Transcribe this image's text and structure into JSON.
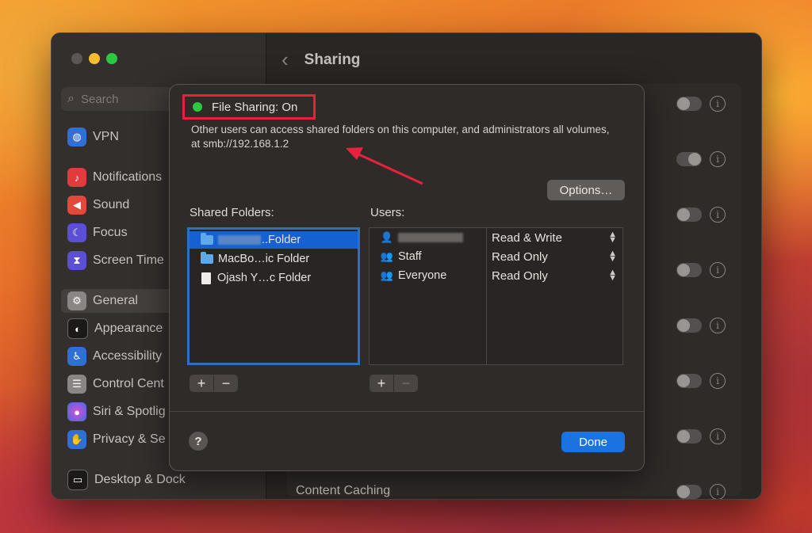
{
  "sidebar": {
    "search_placeholder": "Search",
    "items": [
      {
        "label": "VPN",
        "icon": "globe-icon",
        "color": "#2f6fd6"
      },
      {
        "label": "Notifications",
        "icon": "bell-icon",
        "color": "#e23b3b"
      },
      {
        "label": "Sound",
        "icon": "speaker-icon",
        "color": "#e2493b"
      },
      {
        "label": "Focus",
        "icon": "moon-icon",
        "color": "#5b4fd6"
      },
      {
        "label": "Screen Time",
        "icon": "hourglass-icon",
        "color": "#5b4fd6"
      },
      {
        "label": "General",
        "icon": "gear-icon",
        "color": "#8a8684"
      },
      {
        "label": "Appearance",
        "icon": "appearance-icon",
        "color": "#1c1a19"
      },
      {
        "label": "Accessibility",
        "icon": "accessibility-icon",
        "color": "#2f6fd6"
      },
      {
        "label": "Control Cent",
        "icon": "switches-icon",
        "color": "#8a8684"
      },
      {
        "label": "Siri & Spotlig",
        "icon": "siri-icon",
        "color": "#6a3fc6"
      },
      {
        "label": "Privacy & Se",
        "icon": "hand-icon",
        "color": "#2f6fd6"
      },
      {
        "label": "Desktop & Dock",
        "icon": "dock-icon",
        "color": "#1c1a19"
      }
    ]
  },
  "main": {
    "title": "Sharing",
    "bottom_row_label": "Content Caching"
  },
  "sheet": {
    "status_label": "File Sharing: On",
    "description": "Other users can access shared folders on this computer, and administrators all volumes, at smb://192.168.1.2",
    "options_label": "Options…",
    "shared_folders_label": "Shared Folders:",
    "users_label": "Users:",
    "folders": [
      {
        "name": "..Folder",
        "type": "folder",
        "selected": true
      },
      {
        "name": "MacBo…ic Folder",
        "type": "folder",
        "selected": false
      },
      {
        "name": "Ojash Y…c Folder",
        "type": "document",
        "selected": false
      }
    ],
    "users": [
      {
        "name": "",
        "icon": "person-icon",
        "permission": "Read & Write"
      },
      {
        "name": "Staff",
        "icon": "group-icon",
        "permission": "Read Only"
      },
      {
        "name": "Everyone",
        "icon": "group-icon",
        "permission": "Read Only"
      }
    ],
    "add_symbol": "+",
    "remove_symbol": "−",
    "help_symbol": "?",
    "done_label": "Done"
  },
  "colors": {
    "accent": "#1a73e0",
    "status_on": "#2dc840",
    "highlight_box": "#e8223c"
  }
}
